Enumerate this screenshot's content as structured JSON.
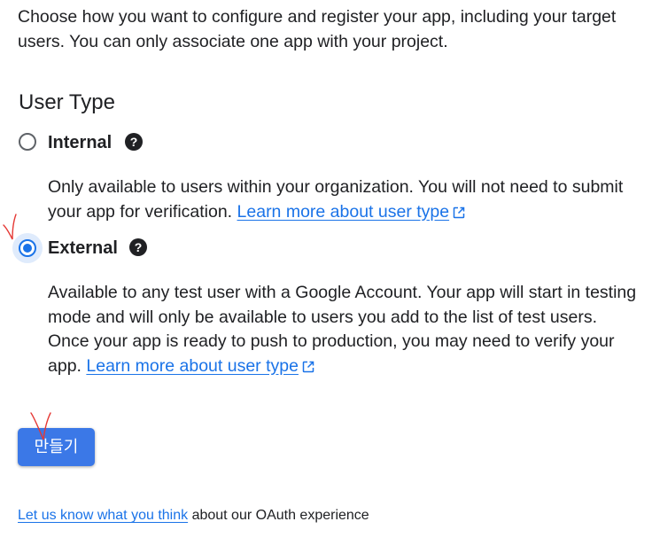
{
  "intro_text": "Choose how you want to configure and register your app, including your target users. You can only associate one app with your project.",
  "user_type": {
    "title": "User Type",
    "options": [
      {
        "label": "Internal",
        "selected": false,
        "description": "Only available to users within your organization. You will not need to submit your app for verification.",
        "link_text": "Learn more about user type"
      },
      {
        "label": "External",
        "selected": true,
        "description": "Available to any test user with a Google Account. Your app will start in testing mode and will only be available to users you add to the list of test users. Once your app is ready to push to production, you may need to verify your app.",
        "link_text": "Learn more about user type"
      }
    ]
  },
  "create_button_label": "만들기",
  "footer": {
    "link_text": "Let us know what you think",
    "text": "about our OAuth experience"
  },
  "colors": {
    "accent": "#1a73e8",
    "button": "#3b78e7",
    "annotation": "#e53935"
  },
  "icons": [
    "help-icon",
    "open-in-new-icon",
    "annotation-check-mark"
  ]
}
